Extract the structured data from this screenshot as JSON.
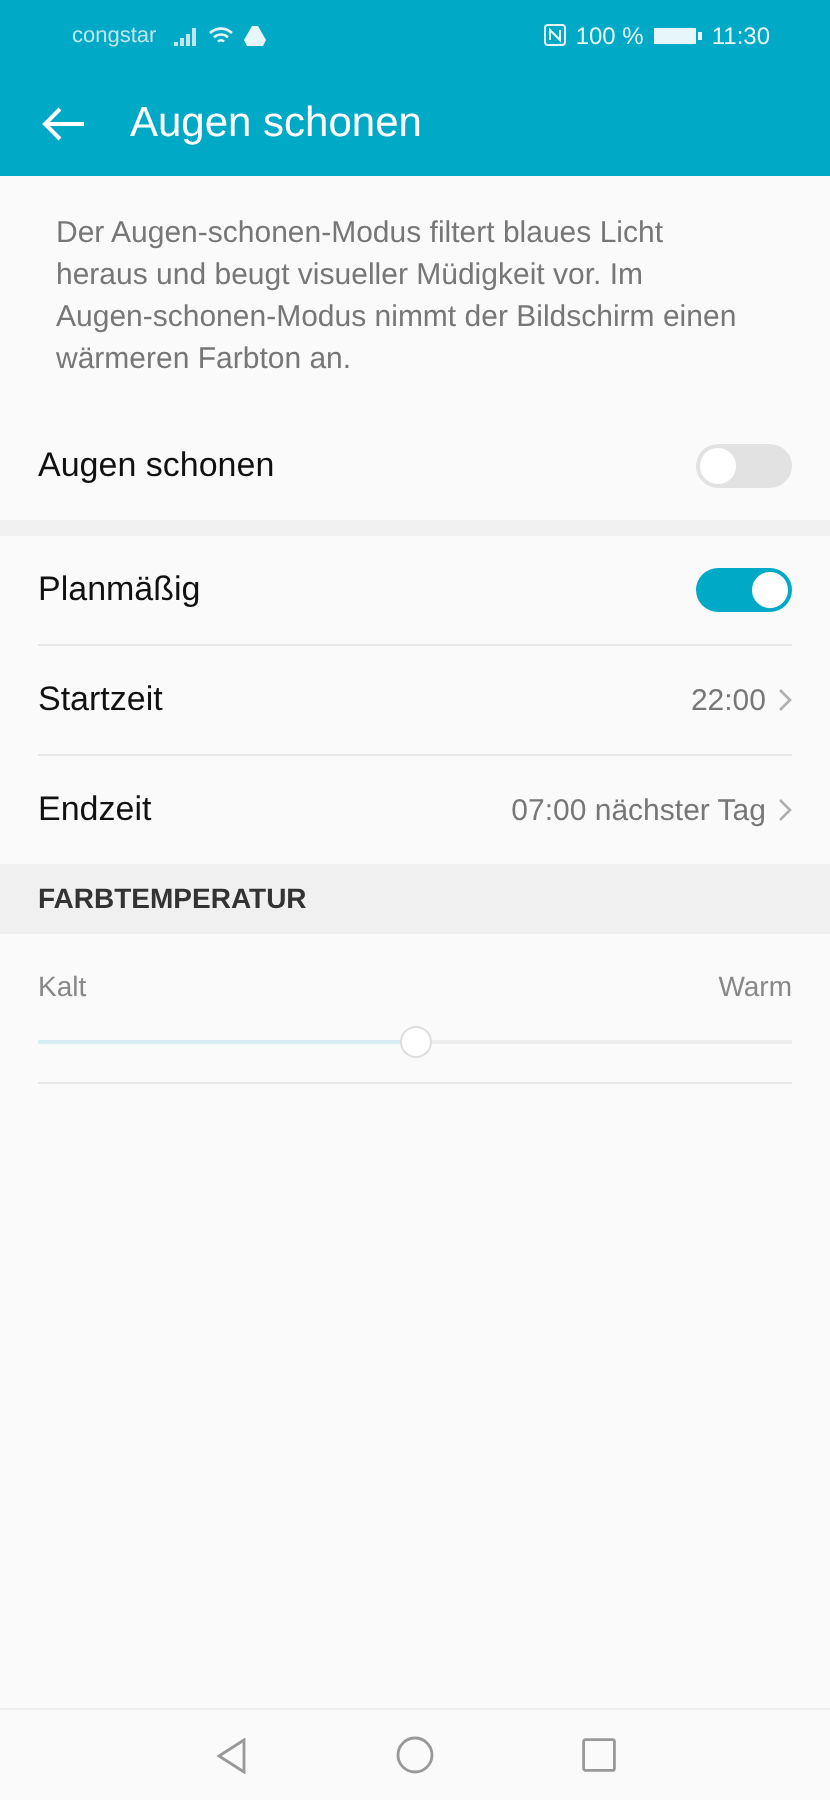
{
  "status_bar": {
    "carrier": "congstar",
    "battery": "100 %",
    "time": "11:30"
  },
  "app_bar": {
    "title": "Augen schonen"
  },
  "description": "Der Augen-schonen-Modus filtert blaues Licht heraus und beugt visueller Müdigkeit vor. Im Augen-schonen-Modus nimmt der Bildschirm einen wärmeren Farbton an.",
  "main_toggle": {
    "label": "Augen schonen",
    "on": false
  },
  "schedule": [
    {
      "kind": "switch",
      "label": "Planmäßig",
      "on": true
    },
    {
      "kind": "link",
      "label": "Startzeit",
      "value": "22:00"
    },
    {
      "kind": "link",
      "label": "Endzeit",
      "value": "07:00 nächster Tag"
    }
  ],
  "color_temperature": {
    "header": "FARBTEMPERATUR",
    "min_label": "Kalt",
    "max_label": "Warm",
    "level": 0.5
  }
}
